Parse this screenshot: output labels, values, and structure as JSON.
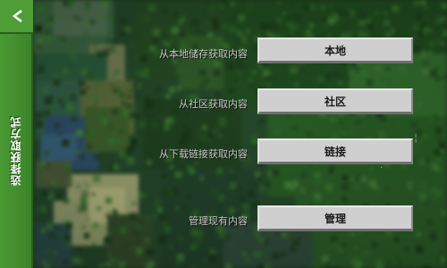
{
  "sidebar": {
    "title": "选择获取方式",
    "back_icon": "chevron-left-icon",
    "color": "#3f8a2b"
  },
  "options": [
    {
      "label": "从本地储存获取内容",
      "button": "本地"
    },
    {
      "label": "从社区获取内容",
      "button": "社区"
    },
    {
      "label": "从下载链接获取内容",
      "button": "链接"
    },
    {
      "label": "管理现有内容",
      "button": "管理"
    }
  ],
  "colors": {
    "button_face": "#cfcfcf",
    "label_text": "#c6c6c6",
    "background": "#1e3a1c"
  }
}
